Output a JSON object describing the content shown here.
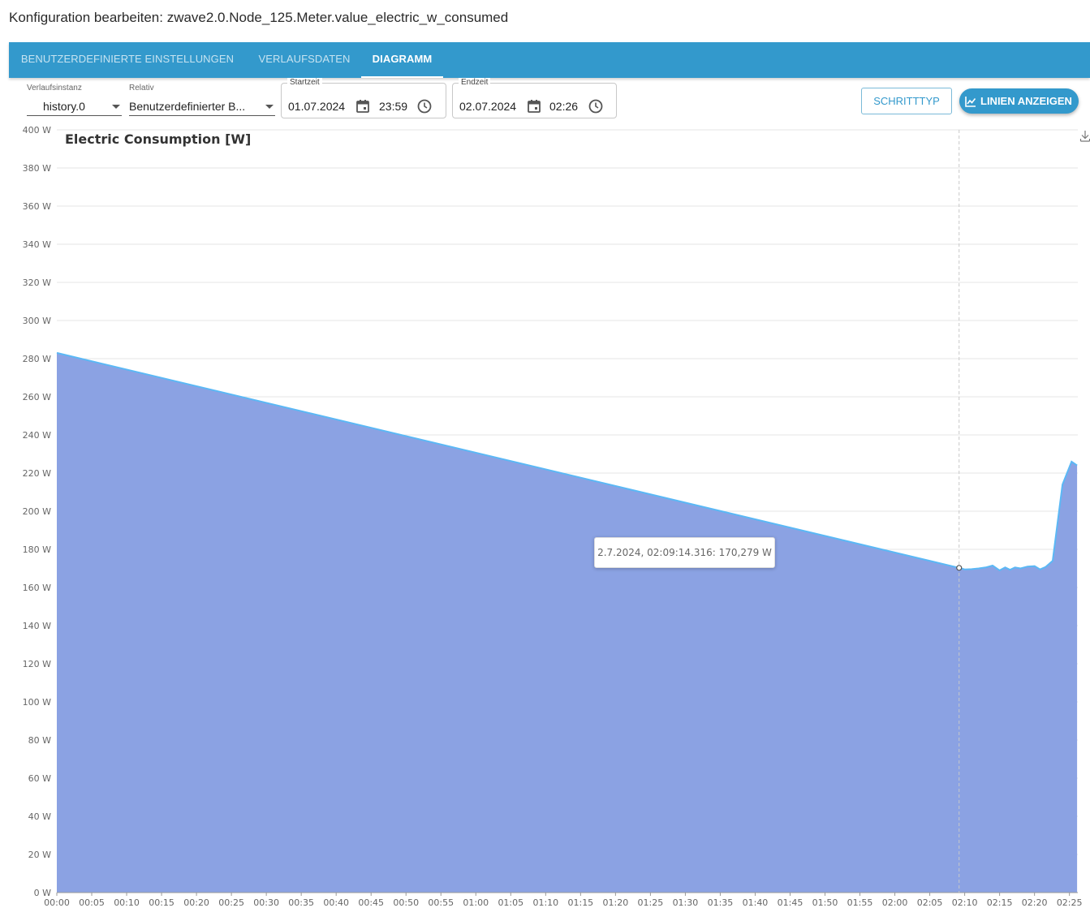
{
  "page": {
    "title": "Konfiguration bearbeiten: zwave2.0.Node_125.Meter.value_electric_w_consumed"
  },
  "tabs": [
    {
      "label": "BENUTZERDEFINIERTE EINSTELLUNGEN",
      "active": false
    },
    {
      "label": "VERLAUFSDATEN",
      "active": false
    },
    {
      "label": "DIAGRAMM",
      "active": true
    }
  ],
  "controls": {
    "instance": {
      "label": "Verlaufsinstanz",
      "value": "history.0"
    },
    "relative": {
      "label": "Relativ",
      "value": "Benutzerdefinierter B..."
    },
    "start": {
      "label": "Startzeit",
      "date": "01.07.2024",
      "time": "23:59"
    },
    "end": {
      "label": "Endzeit",
      "date": "02.07.2024",
      "time": "02:26"
    },
    "step_type_button": "SCHRITTTYP",
    "show_lines_button": "LINIEN ANZEIGEN",
    "icons": [
      "calendar-icon",
      "clock-icon",
      "chart-line-icon",
      "download-icon",
      "caret-down-icon"
    ]
  },
  "colors": {
    "tab_bar": "#3399cc",
    "area_fill": "#8ba2e3",
    "line": "#5bb8f5",
    "accent": "#3399cc"
  },
  "chart_data": {
    "type": "area",
    "title": "Electric Consumption [W]",
    "ylim": [
      0,
      400
    ],
    "yticks": [
      0,
      20,
      40,
      60,
      80,
      100,
      120,
      140,
      160,
      180,
      200,
      220,
      240,
      260,
      280,
      300,
      320,
      340,
      360,
      380,
      400
    ],
    "y_unit": "W",
    "xlim_minutes": [
      0,
      146.2
    ],
    "x_tick_labels": [
      "00:00",
      "00:05",
      "00:10",
      "00:15",
      "00:20",
      "00:25",
      "00:30",
      "00:35",
      "00:40",
      "00:45",
      "00:50",
      "00:55",
      "01:00",
      "01:05",
      "01:10",
      "01:15",
      "01:20",
      "01:25",
      "01:30",
      "01:35",
      "01:40",
      "01:45",
      "01:50",
      "01:55",
      "02:00",
      "02:05",
      "02:10",
      "02:15",
      "02:20",
      "02:25"
    ],
    "grid": "horizontal",
    "series": [
      {
        "x": [
          "00:00",
          "02:09",
          "02:10",
          "02:11",
          "02:12",
          "02:13",
          "02:14",
          "02:15",
          "02:16",
          "02:17",
          "02:18",
          "02:19",
          "02:20",
          "02:21",
          "02:22",
          "02:23",
          "02:24",
          "02:25",
          "02:25:30",
          "02:26"
        ],
        "x_minutes": [
          0,
          129.2,
          130.0,
          131.0,
          132.0,
          133.0,
          134.0,
          135.0,
          135.8,
          136.5,
          137.2,
          138.0,
          139.0,
          140.0,
          140.8,
          141.6,
          142.6,
          144.0,
          145.3,
          146.1
        ],
        "values": [
          283,
          170.3,
          169.5,
          169.6,
          170,
          170.5,
          171.5,
          169,
          170.5,
          169.3,
          170.5,
          170,
          171,
          171.2,
          169.5,
          170.8,
          174,
          214,
          226,
          224
        ]
      }
    ],
    "hover": {
      "x_minutes": 129.2,
      "label": "2.7.2024, 02:09:14.316: 170,279 W"
    }
  }
}
